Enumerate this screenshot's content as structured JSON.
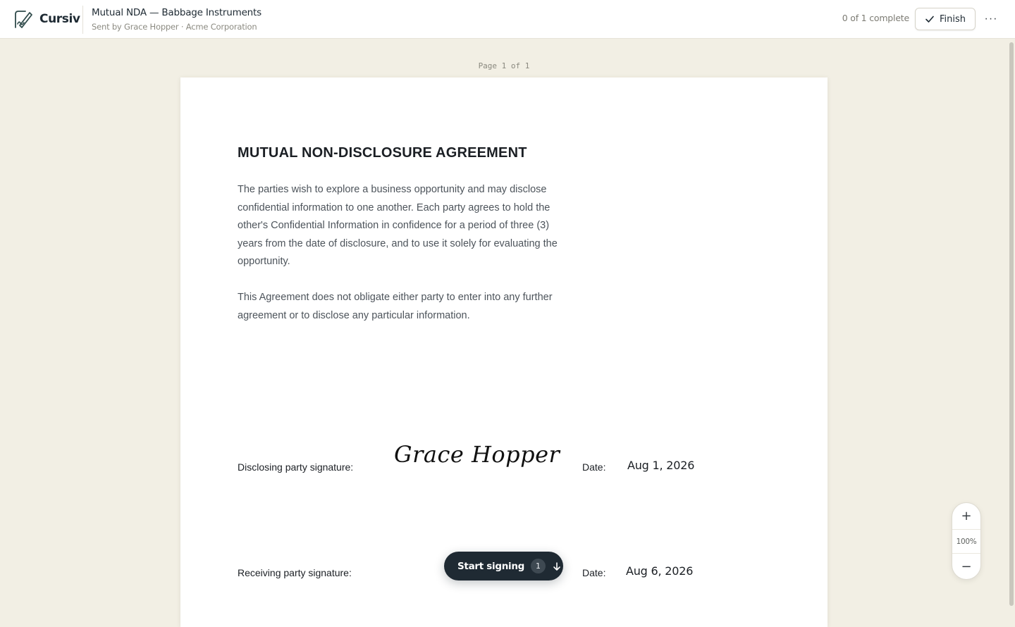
{
  "app": {
    "name": "Cursiv",
    "document_title": "Mutual NDA — Babbage Instruments",
    "sent_by": "Sent by Grace Hopper · Acme Corporation"
  },
  "header": {
    "progress": "0 of 1 complete",
    "finish_label": "Finish",
    "more_label": "···"
  },
  "viewer": {
    "page_indicator": "Page 1 of 1",
    "zoom_level": "100%",
    "zoom_in_label": "+",
    "zoom_out_label": "−"
  },
  "document": {
    "heading": "MUTUAL NON-DISCLOSURE AGREEMENT",
    "paragraphs": [
      "The parties wish to explore a business opportunity and may disclose confidential information to one another. Each party agrees to hold the other's Confidential Information in confidence for a period of three (3) years from the date of disclosure, and to use it solely for evaluating the opportunity.",
      "This Agreement does not obligate either party to enter into any further agreement or to disclose any particular information."
    ],
    "disclosing": {
      "label": "Disclosing party signature:",
      "signature": "Grace Hopper",
      "date_label": "Date:",
      "date": "Aug 1, 2026"
    },
    "receiving": {
      "label": "Receiving party signature:",
      "date_label": "Date:",
      "date": "Aug 6, 2026"
    }
  },
  "signing": {
    "start_label": "Start signing",
    "remaining_count": "1"
  },
  "icons": {
    "logo": "signature-pen-logo",
    "finish": "check-icon",
    "more": "more-icon",
    "start": "arrow-down-icon"
  }
}
